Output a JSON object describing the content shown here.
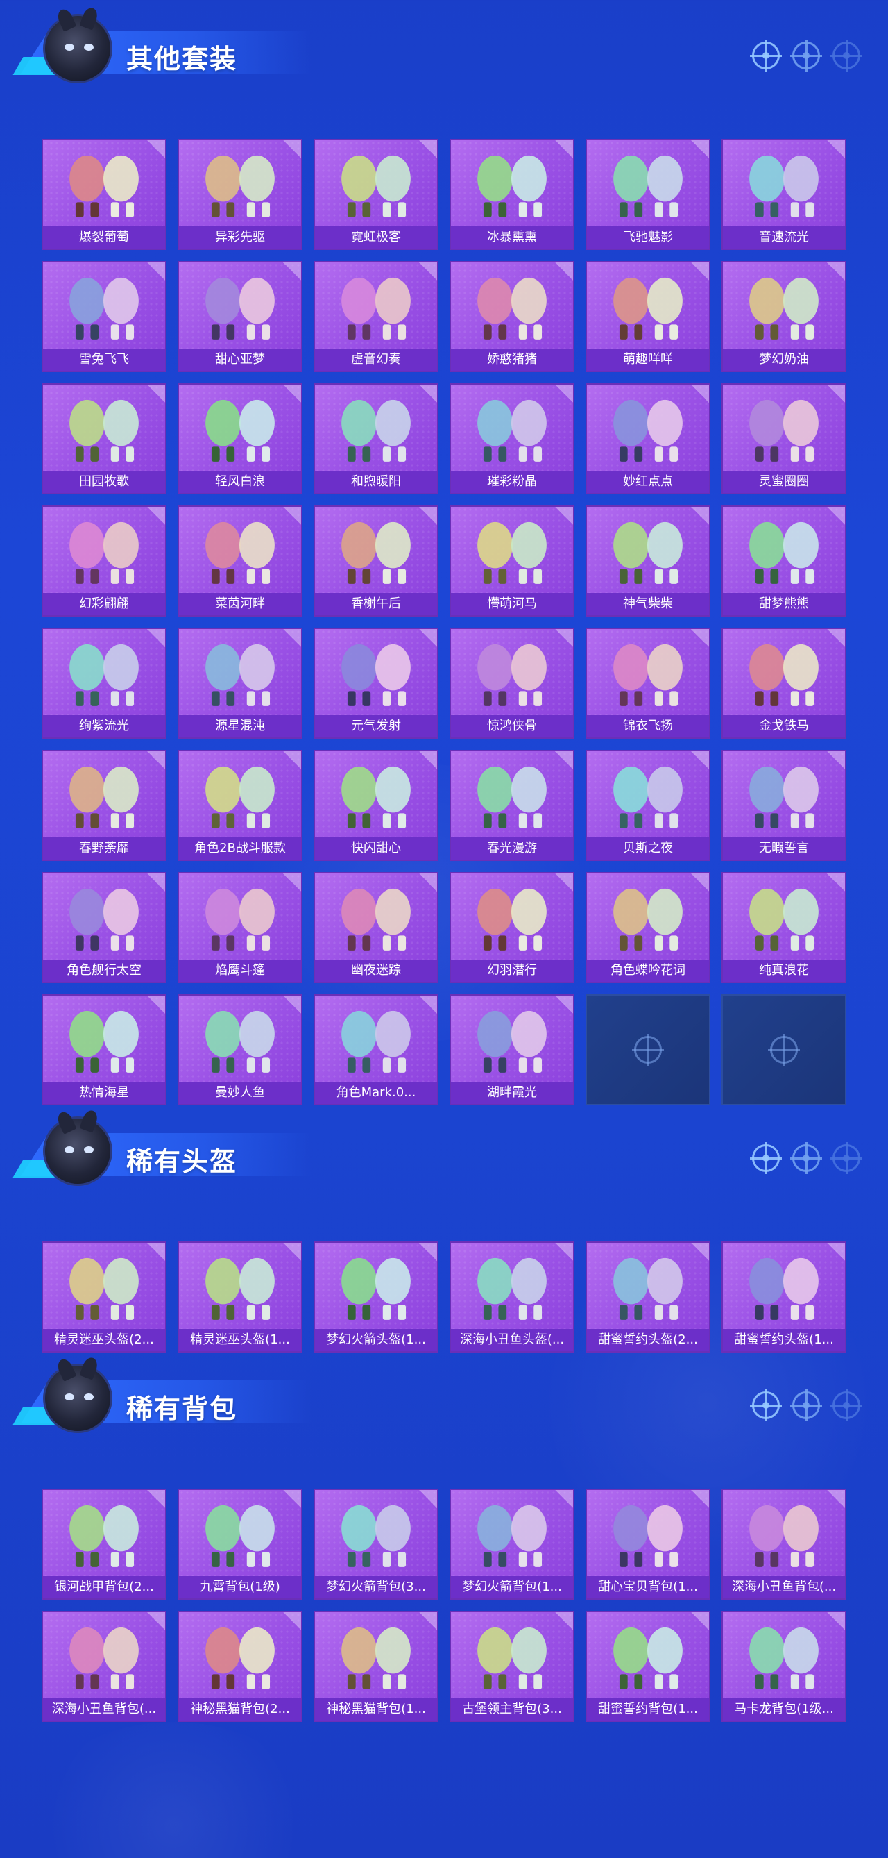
{
  "sections": [
    {
      "title": "其他套装",
      "items": [
        "爆裂葡萄",
        "异彩先驱",
        "霓虹极客",
        "冰暴熏熏",
        "飞驰魅影",
        "音速流光",
        "雪兔飞飞",
        "甜心亚梦",
        "虚音幻奏",
        "娇憨猪猪",
        "萌趣咩咩",
        "梦幻奶油",
        "田园牧歌",
        "轻风白浪",
        "和煦暖阳",
        "璀彩粉晶",
        "妙红点点",
        "灵蜜圈圈",
        "幻彩翩翩",
        "菜茵河畔",
        "香榭午后",
        "懵萌河马",
        "神气柴柴",
        "甜梦熊熊",
        "绚紫流光",
        "源星混沌",
        "元气发射",
        "惊鸿侠骨",
        "锦衣飞扬",
        "金戈铁马",
        "春野荼靡",
        "角色2B战斗服款",
        "快闪甜心",
        "春光漫游",
        "贝斯之夜",
        "无暇誓言",
        "角色舰行太空",
        "焰鹰斗篷",
        "幽夜迷踪",
        "幻羽潜行",
        "角色蝶吟花词",
        "纯真浪花",
        "热情海星",
        "曼妙人鱼",
        "角色Mark.0...",
        "湖畔霞光"
      ],
      "empty_slots": 2
    },
    {
      "title": "稀有头盔",
      "items": [
        "精灵迷巫头盔(2...",
        "精灵迷巫头盔(1...",
        "梦幻火箭头盔(1...",
        "深海小丑鱼头盔(...",
        "甜蜜誓约头盔(2...",
        "甜蜜誓约头盔(1..."
      ],
      "empty_slots": 0
    },
    {
      "title": "稀有背包",
      "items": [
        "银河战甲背包(2...",
        "九霄背包(1级)",
        "梦幻火箭背包(3...",
        "梦幻火箭背包(1...",
        "甜心宝贝背包(1...",
        "深海小丑鱼背包(...",
        "深海小丑鱼背包(...",
        "神秘黑猫背包(2...",
        "神秘黑猫背包(1...",
        "古堡领主背包(3...",
        "甜蜜誓约背包(1...",
        "马卡龙背包(1级..."
      ],
      "empty_slots": 0
    }
  ],
  "icons": {
    "header_target": "crosshair-target-icon",
    "empty_slot": "crosshair-target-icon",
    "mascot": "mascot-avatar-icon"
  },
  "colors": {
    "background": "#1c46d6",
    "card": "#9b52e6",
    "label_bar": "#6c2fc9",
    "empty_card": "#1b3579"
  }
}
